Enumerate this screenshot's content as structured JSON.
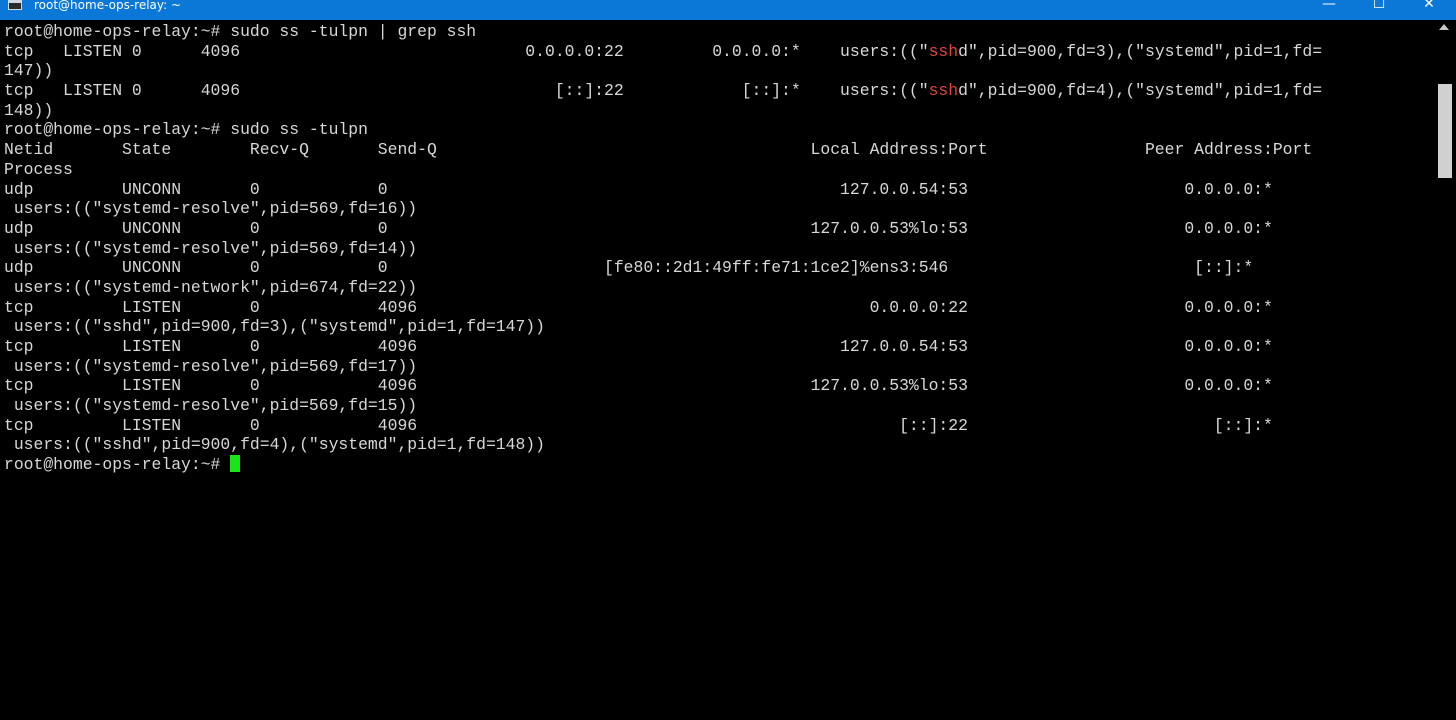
{
  "window": {
    "title": "root@home-ops-relay: ~",
    "controls": {
      "minimize": "—",
      "maximize": "☐",
      "close": "✕"
    }
  },
  "terminal": {
    "cmd1_prompt": "root@home-ops-relay:~# ",
    "cmd1_command": "sudo ss -tulpn | grep ssh",
    "grep_results": [
      {
        "head": "tcp   LISTEN 0      4096                             0.0.0.0:22         0.0.0.0:*    users:((\"",
        "match": "ssh",
        "tail": "d\",pid=900,fd=3),(\"systemd\",pid=1,fd=",
        "wrap": "147))"
      },
      {
        "head": "tcp   LISTEN 0      4096                                [::]:22            [::]:*    users:((\"",
        "match": "ssh",
        "tail": "d\",pid=900,fd=4),(\"systemd\",pid=1,fd=",
        "wrap": "148))"
      }
    ],
    "cmd2_prompt": "root@home-ops-relay:~# ",
    "cmd2_command": "sudo ss -tulpn",
    "header": {
      "line1": "Netid       State        Recv-Q       Send-Q                                      Local Address:Port                Peer Address:Port",
      "line2": "Process"
    },
    "rows": [
      {
        "main": "udp         UNCONN       0            0                                              127.0.0.54:53                      0.0.0.0:*",
        "process": " users:((\"systemd-resolve\",pid=569,fd=16))"
      },
      {
        "main": "udp         UNCONN       0            0                                           127.0.0.53%lo:53                      0.0.0.0:*",
        "process": " users:((\"systemd-resolve\",pid=569,fd=14))"
      },
      {
        "main": "udp         UNCONN       0            0                      [fe80::2d1:49ff:fe71:1ce2]%ens3:546                         [::]:*",
        "process": " users:((\"systemd-network\",pid=674,fd=22))"
      },
      {
        "main": "tcp         LISTEN       0            4096                                              0.0.0.0:22                      0.0.0.0:*",
        "process": " users:((\"sshd\",pid=900,fd=3),(\"systemd\",pid=1,fd=147))"
      },
      {
        "main": "tcp         LISTEN       0            4096                                           127.0.0.54:53                      0.0.0.0:*",
        "process": " users:((\"systemd-resolve\",pid=569,fd=17))"
      },
      {
        "main": "tcp         LISTEN       0            4096                                        127.0.0.53%lo:53                      0.0.0.0:*",
        "process": " users:((\"systemd-resolve\",pid=569,fd=15))"
      },
      {
        "main": "tcp         LISTEN       0            4096                                                 [::]:22                         [::]:*",
        "process": " users:((\"sshd\",pid=900,fd=4),(\"systemd\",pid=1,fd=148))"
      }
    ],
    "final_prompt": "root@home-ops-relay:~# "
  },
  "colors": {
    "titlebar": "#0b78d7",
    "background": "#000000",
    "text": "#d8d8d8",
    "grep_match": "#e0443c",
    "cursor": "#18e618"
  },
  "icons": {
    "app": "terminal-icon",
    "scroll_up": "chevron-up-icon"
  }
}
